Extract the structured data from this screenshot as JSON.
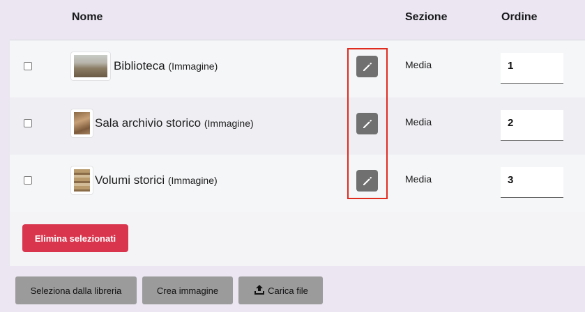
{
  "table": {
    "columns": {
      "name": "Nome",
      "section": "Sezione",
      "order": "Ordine"
    },
    "rows": [
      {
        "title": "Biblioteca",
        "type": "(Immagine)",
        "section": "Media",
        "order": "1",
        "thumbnail": "biblioteca"
      },
      {
        "title": "Sala archivio storico",
        "type": "(Immagine)",
        "section": "Media",
        "order": "2",
        "thumbnail": "sala-archivio-storico"
      },
      {
        "title": "Volumi storici",
        "type": "(Immagine)",
        "section": "Media",
        "order": "3",
        "thumbnail": "volumi-storici"
      }
    ],
    "delete_selected": "Elimina selezionati"
  },
  "actions": {
    "library": "Seleziona dalla libreria",
    "create_image": "Crea immagine",
    "upload": "Carica file"
  },
  "icons": {
    "edit": "pencil-icon",
    "upload": "upload-icon"
  },
  "colors": {
    "page_background": "#ebe6f1",
    "edit_button": "#707070",
    "delete_button": "#d9364e",
    "highlight": "#e02b1f",
    "secondary_button": "#9b9b9c"
  }
}
